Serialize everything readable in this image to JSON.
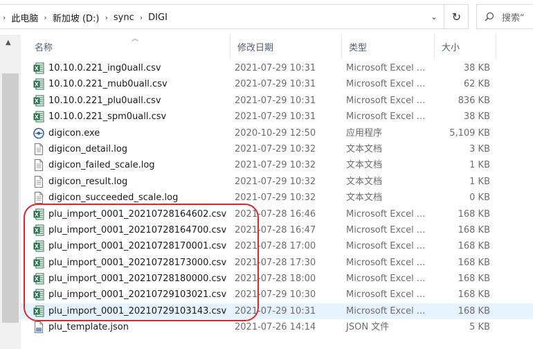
{
  "address": {
    "crumbs": [
      "此电脑",
      "新加坡 (D:)",
      "sync",
      "DIGI"
    ],
    "dropdown_glyph": "⌄",
    "refresh_glyph": "↻"
  },
  "search": {
    "placeholder": "搜索“"
  },
  "columns": {
    "name": "名称",
    "date": "修改日期",
    "type": "类型",
    "size": "大小"
  },
  "files": [
    {
      "name": "10.10.0.221_ing0uall.csv",
      "date": "2021-07-29 10:31",
      "type": "Microsoft Excel ...",
      "size": "38 KB",
      "icon": "excel"
    },
    {
      "name": "10.10.0.221_mub0uall.csv",
      "date": "2021-07-29 10:31",
      "type": "Microsoft Excel ...",
      "size": "62 KB",
      "icon": "excel"
    },
    {
      "name": "10.10.0.221_plu0uall.csv",
      "date": "2021-07-29 10:31",
      "type": "Microsoft Excel ...",
      "size": "836 KB",
      "icon": "excel"
    },
    {
      "name": "10.10.0.221_spm0uall.csv",
      "date": "2021-07-29 10:31",
      "type": "Microsoft Excel ...",
      "size": "38 KB",
      "icon": "excel"
    },
    {
      "name": "digicon.exe",
      "date": "2020-10-29 12:50",
      "type": "应用程序",
      "size": "5,109 KB",
      "icon": "exe"
    },
    {
      "name": "digicon_detail.log",
      "date": "2021-07-29 10:32",
      "type": "文本文档",
      "size": "3 KB",
      "icon": "text"
    },
    {
      "name": "digicon_failed_scale.log",
      "date": "2021-07-29 10:32",
      "type": "文本文档",
      "size": "1 KB",
      "icon": "text"
    },
    {
      "name": "digicon_result.log",
      "date": "2021-07-29 10:32",
      "type": "文本文档",
      "size": "1 KB",
      "icon": "text"
    },
    {
      "name": "digicon_succeeded_scale.log",
      "date": "2021-07-29 10:32",
      "type": "文本文档",
      "size": "0 KB",
      "icon": "text"
    },
    {
      "name": "plu_import_0001_20210728164602.csv",
      "date": "2021-07-28 16:46",
      "type": "Microsoft Excel ...",
      "size": "168 KB",
      "icon": "excel"
    },
    {
      "name": "plu_import_0001_20210728164700.csv",
      "date": "2021-07-28 16:47",
      "type": "Microsoft Excel ...",
      "size": "168 KB",
      "icon": "excel"
    },
    {
      "name": "plu_import_0001_20210728170001.csv",
      "date": "2021-07-28 17:00",
      "type": "Microsoft Excel ...",
      "size": "168 KB",
      "icon": "excel"
    },
    {
      "name": "plu_import_0001_20210728173000.csv",
      "date": "2021-07-28 17:30",
      "type": "Microsoft Excel ...",
      "size": "168 KB",
      "icon": "excel"
    },
    {
      "name": "plu_import_0001_20210728180000.csv",
      "date": "2021-07-28 18:00",
      "type": "Microsoft Excel ...",
      "size": "168 KB",
      "icon": "excel"
    },
    {
      "name": "plu_import_0001_20210729103021.csv",
      "date": "2021-07-29 10:30",
      "type": "Microsoft Excel ...",
      "size": "168 KB",
      "icon": "excel"
    },
    {
      "name": "plu_import_0001_20210729103143.csv",
      "date": "2021-07-29 10:31",
      "type": "Microsoft Excel ...",
      "size": "168 KB",
      "icon": "excel",
      "selected": true
    },
    {
      "name": "plu_template.json",
      "date": "2021-07-26 14:14",
      "type": "JSON 文件",
      "size": "5 KB",
      "icon": "json"
    }
  ],
  "colors": {
    "excel": "#1f7244",
    "selection": "#e5f3ff",
    "annotation": "#e0262b",
    "header_text": "#4c607a"
  }
}
